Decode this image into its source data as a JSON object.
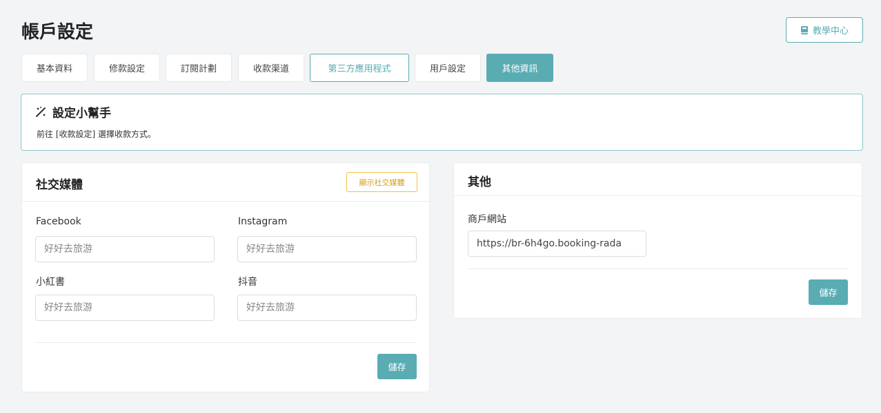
{
  "header": {
    "title": "帳戶設定",
    "help_button": "教學中心",
    "help_icon": "book-icon"
  },
  "tabs": [
    {
      "label": "基本資料"
    },
    {
      "label": "修款設定"
    },
    {
      "label": "訂閱計劃"
    },
    {
      "label": "收款渠道"
    },
    {
      "label": "第三方應用程式"
    },
    {
      "label": "用戶設定"
    },
    {
      "label": "其他資訊"
    }
  ],
  "helper": {
    "title": "設定小幫手",
    "icon": "magic-wand-icon",
    "text": "前往 [收款設定] 選擇收款方式。"
  },
  "social": {
    "title": "社交媒體",
    "show_button": "顯示社交媒體",
    "fields": [
      {
        "label": "Facebook",
        "placeholder": "好好去旅游"
      },
      {
        "label": "Instagram",
        "placeholder": "好好去旅游"
      },
      {
        "label": "小紅書",
        "placeholder": "好好去旅游"
      },
      {
        "label": "抖音",
        "placeholder": "好好去旅游"
      }
    ],
    "save_button": "儲存"
  },
  "other": {
    "title": "其他",
    "website_label": "商戶網站",
    "website_value": "https://br-6h4go.booking-rada",
    "save_button": "儲存"
  },
  "colors": {
    "accent": "#5aacb3",
    "warning": "#f0c040"
  }
}
